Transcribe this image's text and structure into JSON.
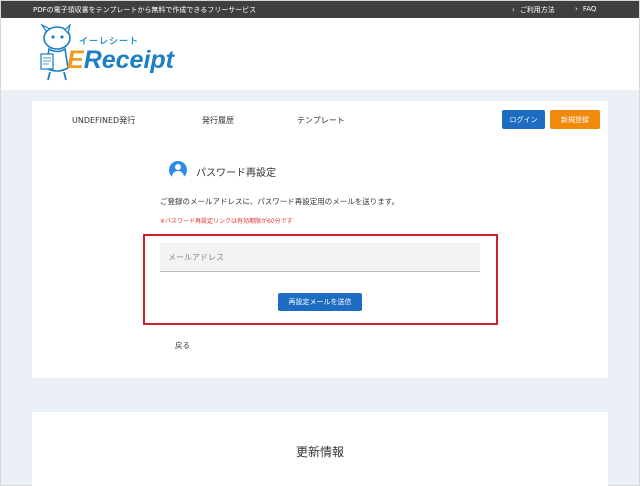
{
  "topbar": {
    "tagline": "PDFの電子領収書をテンプレートから無料で作成できるフリーサービス",
    "links": [
      {
        "label": "ご利用方法"
      },
      {
        "label": "FAQ"
      }
    ]
  },
  "logo": {
    "kana": "イーレシート",
    "brand_e": "E",
    "brand_rest": "Receipt"
  },
  "nav": {
    "items": [
      {
        "label": "UNDEFINED発行"
      },
      {
        "label": "発行履歴"
      },
      {
        "label": "テンプレート"
      }
    ],
    "login_label": "ログイン",
    "register_label": "新規登録"
  },
  "form": {
    "title": "パスワード再設定",
    "description": "ご登録のメールアドレスに、パスワード再設定用のメールを送ります。",
    "note": "※パスワード再設定リンクは有効期限が60分です",
    "email_placeholder": "メールアドレス",
    "email_value": "",
    "send_label": "再設定メールを送信",
    "back_label": "戻る"
  },
  "news": {
    "title": "更新情報"
  },
  "colors": {
    "primary": "#1e6cc1",
    "accent": "#f1890c",
    "highlight": "#c8202c",
    "topbar": "#3f3f3f",
    "background": "#eaf0f6"
  }
}
